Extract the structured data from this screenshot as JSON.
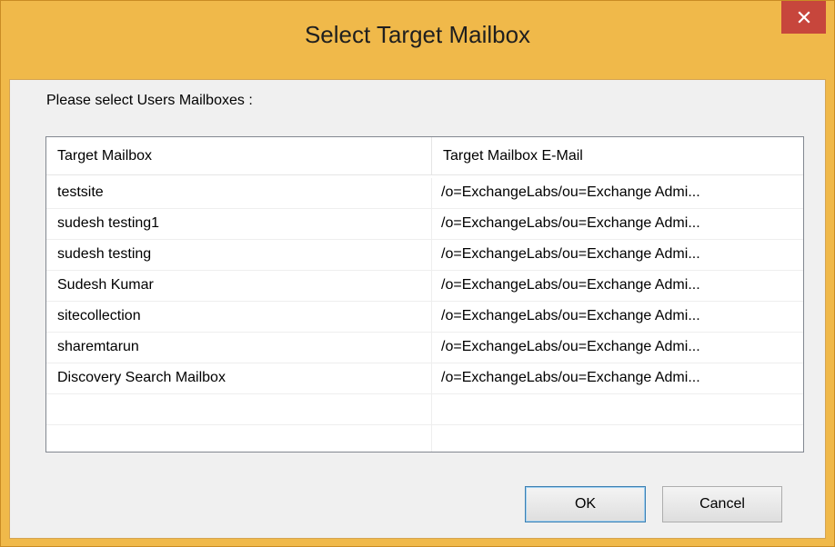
{
  "window": {
    "title": "Select Target Mailbox",
    "close_icon": "close-icon"
  },
  "dialog": {
    "prompt": "Please select Users Mailboxes :"
  },
  "table": {
    "columns": [
      "Target Mailbox",
      "Target Mailbox E-Mail"
    ],
    "rows": [
      {
        "name": "testsite",
        "email": "/o=ExchangeLabs/ou=Exchange Admi..."
      },
      {
        "name": "sudesh testing1",
        "email": "/o=ExchangeLabs/ou=Exchange Admi..."
      },
      {
        "name": "sudesh testing",
        "email": "/o=ExchangeLabs/ou=Exchange Admi..."
      },
      {
        "name": "Sudesh Kumar",
        "email": "/o=ExchangeLabs/ou=Exchange Admi..."
      },
      {
        "name": "sitecollection",
        "email": "/o=ExchangeLabs/ou=Exchange Admi..."
      },
      {
        "name": "sharemtarun",
        "email": "/o=ExchangeLabs/ou=Exchange Admi..."
      },
      {
        "name": "Discovery Search Mailbox",
        "email": "/o=ExchangeLabs/ou=Exchange Admi..."
      }
    ],
    "empty_rows": 2
  },
  "buttons": {
    "ok_label": "OK",
    "cancel_label": "Cancel"
  },
  "colors": {
    "title_bar": "#f0b94a",
    "close_button": "#c7463c",
    "client_background": "#f0f0f0",
    "default_button_border": "#3c7fb1"
  }
}
